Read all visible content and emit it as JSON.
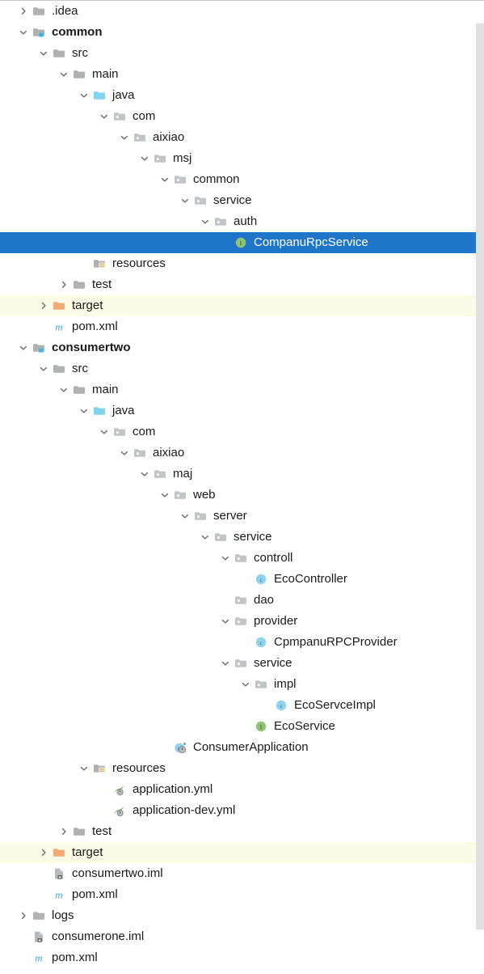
{
  "panel": {
    "name": "project-tree",
    "selection_color": "#1f76c8",
    "excluded_color": "#fcfce6",
    "background": "#ffffff"
  },
  "scrollbar": {
    "name": "vertical-scrollbar",
    "thumb_color": "#e0e0e0"
  },
  "tree": {
    "rows": [
      {
        "label": ".idea",
        "depth": 1,
        "state": "collapsed",
        "icon": "folder-gray",
        "bold": false,
        "row": "normal"
      },
      {
        "label": "common",
        "depth": 1,
        "state": "expanded",
        "icon": "folder-module",
        "bold": true,
        "row": "normal"
      },
      {
        "label": "src",
        "depth": 2,
        "state": "expanded",
        "icon": "folder-gray",
        "bold": false,
        "row": "normal"
      },
      {
        "label": "main",
        "depth": 3,
        "state": "expanded",
        "icon": "folder-gray",
        "bold": false,
        "row": "normal"
      },
      {
        "label": "java",
        "depth": 4,
        "state": "expanded",
        "icon": "folder-source",
        "bold": false,
        "row": "normal"
      },
      {
        "label": "com",
        "depth": 5,
        "state": "expanded",
        "icon": "folder-package",
        "bold": false,
        "row": "normal"
      },
      {
        "label": "aixiao",
        "depth": 6,
        "state": "expanded",
        "icon": "folder-package",
        "bold": false,
        "row": "normal"
      },
      {
        "label": "msj",
        "depth": 7,
        "state": "expanded",
        "icon": "folder-package",
        "bold": false,
        "row": "normal"
      },
      {
        "label": "common",
        "depth": 8,
        "state": "expanded",
        "icon": "folder-package",
        "bold": false,
        "row": "normal"
      },
      {
        "label": "service",
        "depth": 9,
        "state": "expanded",
        "icon": "folder-package",
        "bold": false,
        "row": "normal"
      },
      {
        "label": "auth",
        "depth": 10,
        "state": "expanded",
        "icon": "folder-package",
        "bold": false,
        "row": "normal"
      },
      {
        "label": "CompanuRpcService",
        "depth": 11,
        "state": "leaf",
        "icon": "java-interface",
        "bold": false,
        "row": "selected"
      },
      {
        "label": "resources",
        "depth": 4,
        "state": "leaf",
        "icon": "folder-resources",
        "bold": false,
        "row": "normal"
      },
      {
        "label": "test",
        "depth": 3,
        "state": "collapsed",
        "icon": "folder-gray",
        "bold": false,
        "row": "normal"
      },
      {
        "label": "target",
        "depth": 2,
        "state": "collapsed",
        "icon": "folder-excluded",
        "bold": false,
        "row": "excluded"
      },
      {
        "label": "pom.xml",
        "depth": 2,
        "state": "leaf",
        "icon": "maven-pom",
        "bold": false,
        "row": "normal"
      },
      {
        "label": "consumertwo",
        "depth": 1,
        "state": "expanded",
        "icon": "folder-module",
        "bold": true,
        "row": "normal"
      },
      {
        "label": "src",
        "depth": 2,
        "state": "expanded",
        "icon": "folder-gray",
        "bold": false,
        "row": "normal"
      },
      {
        "label": "main",
        "depth": 3,
        "state": "expanded",
        "icon": "folder-gray",
        "bold": false,
        "row": "normal"
      },
      {
        "label": "java",
        "depth": 4,
        "state": "expanded",
        "icon": "folder-source",
        "bold": false,
        "row": "normal"
      },
      {
        "label": "com",
        "depth": 5,
        "state": "expanded",
        "icon": "folder-package",
        "bold": false,
        "row": "normal"
      },
      {
        "label": "aixiao",
        "depth": 6,
        "state": "expanded",
        "icon": "folder-package",
        "bold": false,
        "row": "normal"
      },
      {
        "label": "maj",
        "depth": 7,
        "state": "expanded",
        "icon": "folder-package",
        "bold": false,
        "row": "normal"
      },
      {
        "label": "web",
        "depth": 8,
        "state": "expanded",
        "icon": "folder-package",
        "bold": false,
        "row": "normal"
      },
      {
        "label": "server",
        "depth": 9,
        "state": "expanded",
        "icon": "folder-package",
        "bold": false,
        "row": "normal"
      },
      {
        "label": "service",
        "depth": 10,
        "state": "expanded",
        "icon": "folder-package",
        "bold": false,
        "row": "normal"
      },
      {
        "label": "controll",
        "depth": 11,
        "state": "expanded",
        "icon": "folder-package",
        "bold": false,
        "row": "normal"
      },
      {
        "label": "EcoController",
        "depth": 12,
        "state": "leaf",
        "icon": "java-class",
        "bold": false,
        "row": "normal"
      },
      {
        "label": "dao",
        "depth": 11,
        "state": "leaf",
        "icon": "folder-package",
        "bold": false,
        "row": "normal"
      },
      {
        "label": "provider",
        "depth": 11,
        "state": "expanded",
        "icon": "folder-package",
        "bold": false,
        "row": "normal"
      },
      {
        "label": "CpmpanuRPCProvider",
        "depth": 12,
        "state": "leaf",
        "icon": "java-class",
        "bold": false,
        "row": "normal"
      },
      {
        "label": "service",
        "depth": 11,
        "state": "expanded",
        "icon": "folder-package",
        "bold": false,
        "row": "normal"
      },
      {
        "label": "impl",
        "depth": 12,
        "state": "expanded",
        "icon": "folder-package",
        "bold": false,
        "row": "normal"
      },
      {
        "label": "EcoServceImpl",
        "depth": 13,
        "state": "leaf",
        "icon": "java-class",
        "bold": false,
        "row": "normal"
      },
      {
        "label": "EcoService",
        "depth": 12,
        "state": "leaf",
        "icon": "java-interface",
        "bold": false,
        "row": "normal"
      },
      {
        "label": "ConsumerApplication",
        "depth": 8,
        "state": "leaf",
        "icon": "spring-boot-class",
        "bold": false,
        "row": "normal"
      },
      {
        "label": "resources",
        "depth": 4,
        "state": "expanded",
        "icon": "folder-resources",
        "bold": false,
        "row": "normal"
      },
      {
        "label": "application.yml",
        "depth": 5,
        "state": "leaf",
        "icon": "spring-yaml",
        "bold": false,
        "row": "normal"
      },
      {
        "label": "application-dev.yml",
        "depth": 5,
        "state": "leaf",
        "icon": "spring-yaml",
        "bold": false,
        "row": "normal"
      },
      {
        "label": "test",
        "depth": 3,
        "state": "collapsed",
        "icon": "folder-gray",
        "bold": false,
        "row": "normal"
      },
      {
        "label": "target",
        "depth": 2,
        "state": "collapsed",
        "icon": "folder-excluded",
        "bold": false,
        "row": "excluded"
      },
      {
        "label": "consumertwo.iml",
        "depth": 2,
        "state": "leaf",
        "icon": "iml-module",
        "bold": false,
        "row": "normal"
      },
      {
        "label": "pom.xml",
        "depth": 2,
        "state": "leaf",
        "icon": "maven-pom",
        "bold": false,
        "row": "normal"
      },
      {
        "label": "logs",
        "depth": 1,
        "state": "collapsed",
        "icon": "folder-gray",
        "bold": false,
        "row": "normal"
      },
      {
        "label": "consumerone.iml",
        "depth": 1,
        "state": "leaf",
        "icon": "iml-module",
        "bold": false,
        "row": "normal"
      },
      {
        "label": "pom.xml",
        "depth": 1,
        "state": "leaf",
        "icon": "maven-pom",
        "bold": false,
        "row": "normal"
      }
    ]
  }
}
